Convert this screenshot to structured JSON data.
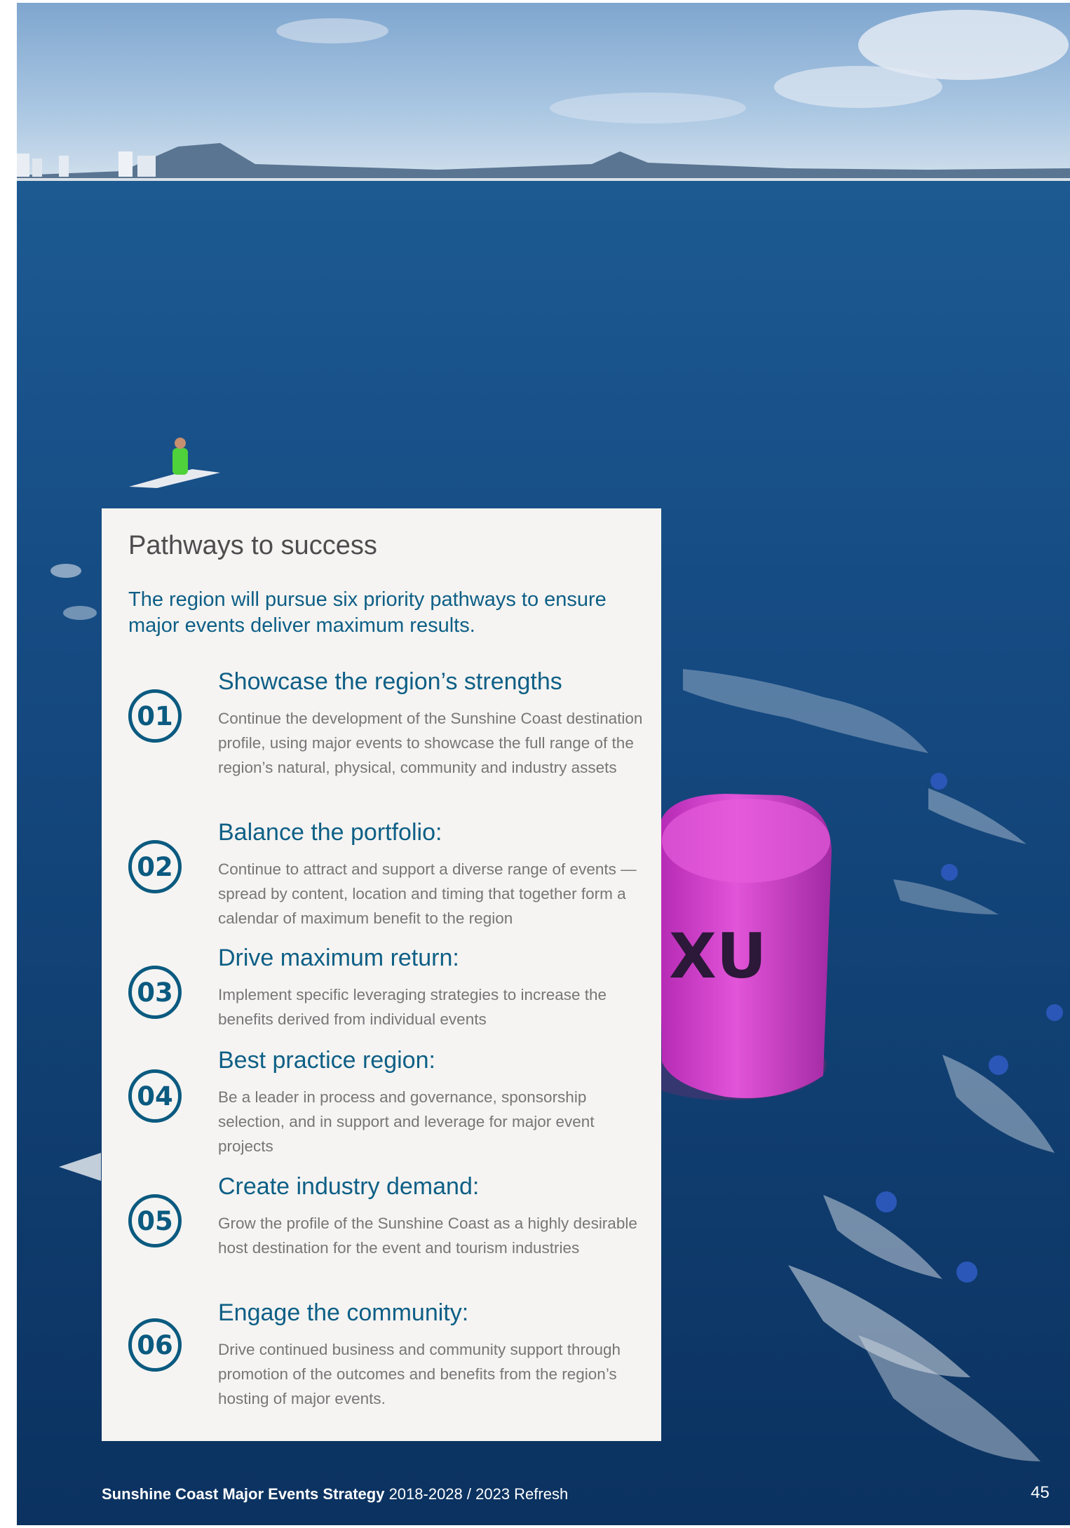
{
  "panel": {
    "title": "Pathways to success",
    "intro": "The region will pursue six priority pathways to ensure major events deliver maximum results."
  },
  "pathways": [
    {
      "number": "01",
      "title": "Showcase the region’s strengths",
      "body": "Continue the development of the Sunshine Coast destination profile, using major events to showcase the full range of the region’s natural, physical, community and industry assets"
    },
    {
      "number": "02",
      "title": "Balance the portfolio:",
      "body": "Continue to attract and support a diverse range of events — spread by content, location and timing that together form a calendar of maximum benefit to the region"
    },
    {
      "number": "03",
      "title": "Drive maximum return:",
      "body": "Implement specific leveraging strategies to increase the benefits derived from individual events"
    },
    {
      "number": "04",
      "title": "Best practice region:",
      "body": "Be a leader in process and governance, sponsorship selection, and in support and leverage for major event projects"
    },
    {
      "number": "05",
      "title": "Create industry demand:",
      "body": "Grow the profile of the Sunshine Coast as a highly desirable host destination for the event and tourism industries"
    },
    {
      "number": "06",
      "title": "Engage the community:",
      "body": "Drive continued business and community support through promotion of the outcomes and benefits from the region’s hosting of major events."
    }
  ],
  "footer": {
    "title": "Sunshine Coast Major Events Strategy",
    "subtitle": "2018-2028 / 2023 Refresh",
    "page_number": "45"
  },
  "buoy_text": "XU"
}
